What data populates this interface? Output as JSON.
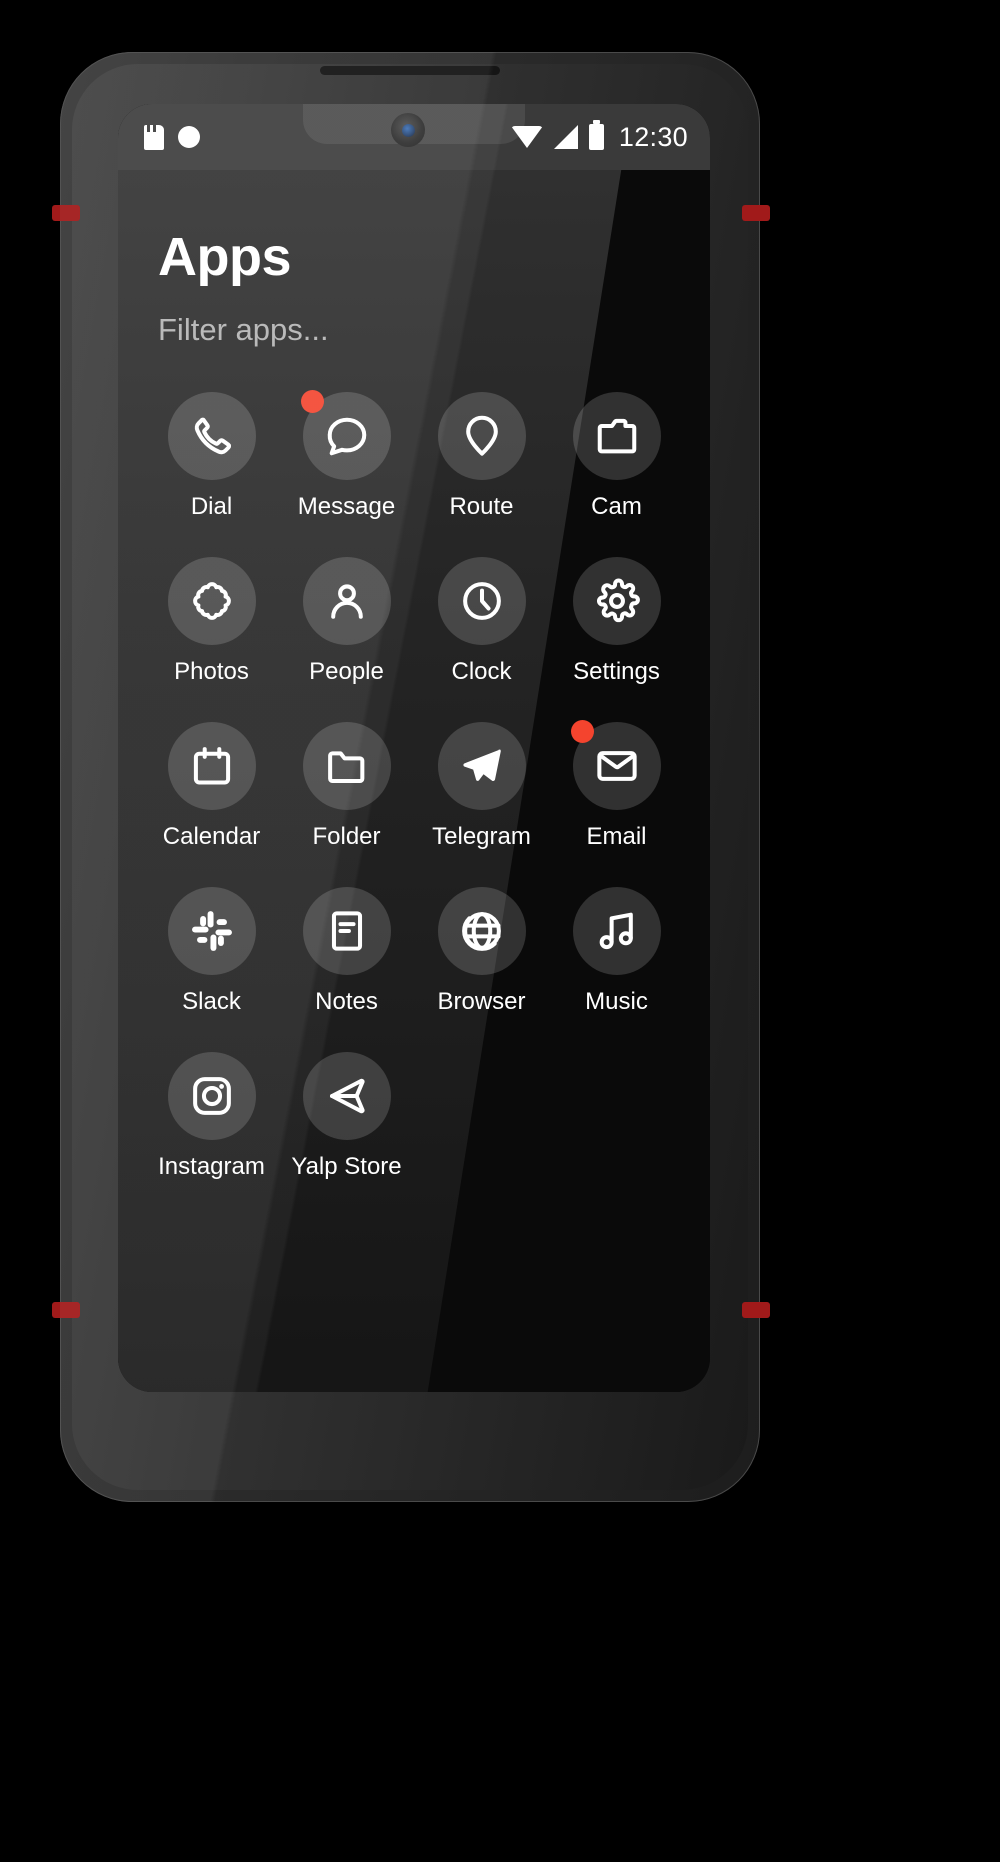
{
  "device": {
    "name": "smartphone-mockup",
    "accent_color": "#a11a1a"
  },
  "statusbar": {
    "left_icons": [
      "sdcard-icon",
      "record-dot-icon"
    ],
    "right_icons": [
      "wifi-icon",
      "cellular-signal-icon",
      "battery-icon"
    ],
    "clock": "12:30"
  },
  "drawer": {
    "title": "Apps",
    "filter": {
      "value": "",
      "placeholder": "Filter apps..."
    },
    "badge_color": "#f4442e",
    "apps": [
      {
        "label": "Dial",
        "icon": "phone-icon",
        "badge": false
      },
      {
        "label": "Message",
        "icon": "chat-bubble-icon",
        "badge": true
      },
      {
        "label": "Route",
        "icon": "map-pin-icon",
        "badge": false
      },
      {
        "label": "Cam",
        "icon": "camera-icon",
        "badge": false
      },
      {
        "label": "Photos",
        "icon": "flower-icon",
        "badge": false
      },
      {
        "label": "People",
        "icon": "person-icon",
        "badge": false
      },
      {
        "label": "Clock",
        "icon": "clock-icon",
        "badge": false
      },
      {
        "label": "Settings",
        "icon": "gear-icon",
        "badge": false
      },
      {
        "label": "Calendar",
        "icon": "calendar-icon",
        "badge": false
      },
      {
        "label": "Folder",
        "icon": "folder-icon",
        "badge": false
      },
      {
        "label": "Telegram",
        "icon": "paper-plane-icon",
        "badge": false
      },
      {
        "label": "Email",
        "icon": "envelope-icon",
        "badge": true
      },
      {
        "label": "Slack",
        "icon": "slack-icon",
        "badge": false
      },
      {
        "label": "Notes",
        "icon": "note-page-icon",
        "badge": false
      },
      {
        "label": "Browser",
        "icon": "globe-icon",
        "badge": false
      },
      {
        "label": "Music",
        "icon": "music-note-icon",
        "badge": false
      },
      {
        "label": "Instagram",
        "icon": "instagram-icon",
        "badge": false
      },
      {
        "label": "Yalp Store",
        "icon": "play-store-icon",
        "badge": false
      }
    ]
  }
}
